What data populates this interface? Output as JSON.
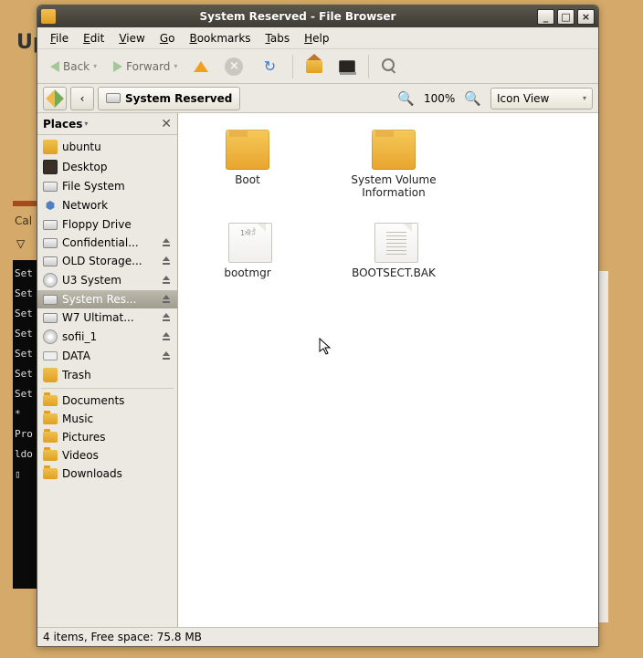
{
  "background": {
    "update_label": "Up",
    "cal_label": "Cal",
    "tri": "▽",
    "term_lines": [
      "Set",
      "Set",
      "Set",
      "Set",
      "Set",
      "Set",
      "Set",
      " *",
      "Pro",
      "ldo",
      "▯"
    ]
  },
  "window": {
    "title": "System Reserved - File Browser"
  },
  "menubar": [
    "File",
    "Edit",
    "View",
    "Go",
    "Bookmarks",
    "Tabs",
    "Help"
  ],
  "toolbar": {
    "back": "Back",
    "forward": "Forward"
  },
  "location": {
    "path": "System Reserved",
    "zoom": "100%",
    "view": "Icon View"
  },
  "sidebar": {
    "header": "Places",
    "items": [
      {
        "label": "ubuntu",
        "icon": "home",
        "eject": false
      },
      {
        "label": "Desktop",
        "icon": "desk",
        "eject": false
      },
      {
        "label": "File System",
        "icon": "disk",
        "eject": false
      },
      {
        "label": "Network",
        "icon": "net",
        "eject": false
      },
      {
        "label": "Floppy Drive",
        "icon": "disk",
        "eject": false
      },
      {
        "label": "Confidential...",
        "icon": "disk",
        "eject": true
      },
      {
        "label": "OLD Storage...",
        "icon": "disk",
        "eject": true
      },
      {
        "label": "U3 System",
        "icon": "cd",
        "eject": true
      },
      {
        "label": "System Res...",
        "icon": "disk",
        "eject": true,
        "selected": true
      },
      {
        "label": "W7 Ultimat...",
        "icon": "disk",
        "eject": true
      },
      {
        "label": "sofii_1",
        "icon": "cd",
        "eject": true
      },
      {
        "label": "DATA",
        "icon": "usb",
        "eject": true
      },
      {
        "label": "Trash",
        "icon": "trash",
        "eject": false
      }
    ],
    "bookmarks": [
      {
        "label": "Documents",
        "icon": "fold"
      },
      {
        "label": "Music",
        "icon": "fold"
      },
      {
        "label": "Pictures",
        "icon": "fold"
      },
      {
        "label": "Videos",
        "icon": "fold"
      },
      {
        "label": "Downloads",
        "icon": "fold"
      }
    ]
  },
  "files": [
    {
      "name": "Boot",
      "type": "folder"
    },
    {
      "name": "System Volume Information",
      "type": "folder"
    },
    {
      "name": "bootmgr",
      "type": "bin"
    },
    {
      "name": "BOOTSECT.BAK",
      "type": "txt"
    }
  ],
  "status": "4 items, Free space: 75.8 MB"
}
